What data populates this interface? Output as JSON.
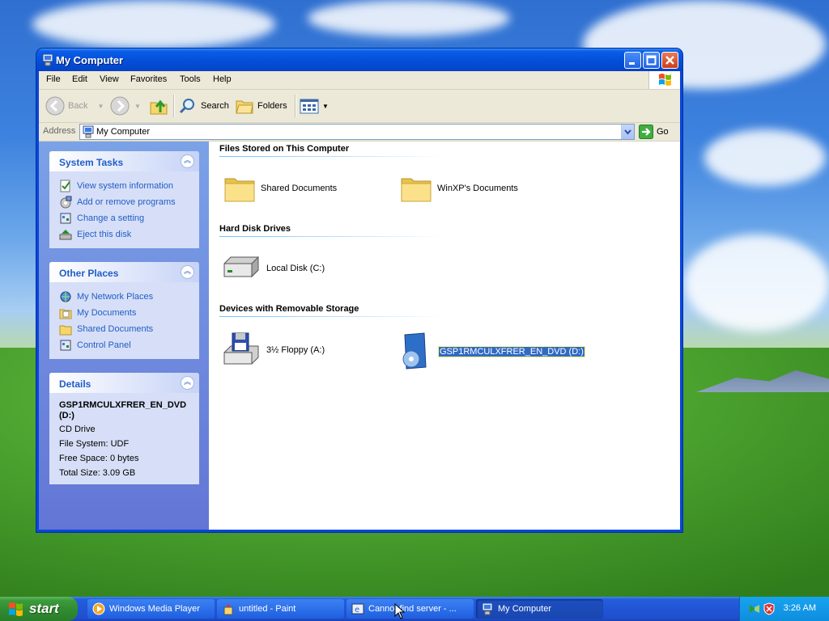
{
  "window": {
    "title": "My Computer"
  },
  "menu": [
    "File",
    "Edit",
    "View",
    "Favorites",
    "Tools",
    "Help"
  ],
  "toolbar": {
    "back": "Back",
    "search": "Search",
    "folders": "Folders"
  },
  "address": {
    "label": "Address",
    "value": "My Computer",
    "go": "Go"
  },
  "sidebar": {
    "system_tasks": {
      "title": "System Tasks",
      "items": [
        "View system information",
        "Add or remove programs",
        "Change a setting",
        "Eject this disk"
      ]
    },
    "other_places": {
      "title": "Other Places",
      "items": [
        "My Network Places",
        "My Documents",
        "Shared Documents",
        "Control Panel"
      ]
    },
    "details": {
      "title": "Details",
      "name": "GSP1RMCULXFRER_EN_DVD (D:)",
      "type": "CD Drive",
      "filesystem": "File System: UDF",
      "free": "Free Space: 0 bytes",
      "total": "Total Size: 3.09 GB"
    }
  },
  "content": {
    "groups": [
      {
        "title": "Files Stored on This Computer",
        "items": [
          "Shared Documents",
          "WinXP's Documents"
        ]
      },
      {
        "title": "Hard Disk Drives",
        "items": [
          "Local Disk (C:)"
        ]
      },
      {
        "title": "Devices with Removable Storage",
        "items": [
          "3½ Floppy (A:)",
          "GSP1RMCULXFRER_EN_DVD (D:)"
        ]
      }
    ]
  },
  "taskbar": {
    "start": "start",
    "buttons": [
      "Windows Media Player",
      "untitled - Paint",
      "Cannot find server - ...",
      "My Computer"
    ],
    "clock": "3:26 AM"
  },
  "colors": {
    "accent": "#0a46d8",
    "link": "#215dc6",
    "selection": "#316ac5"
  }
}
